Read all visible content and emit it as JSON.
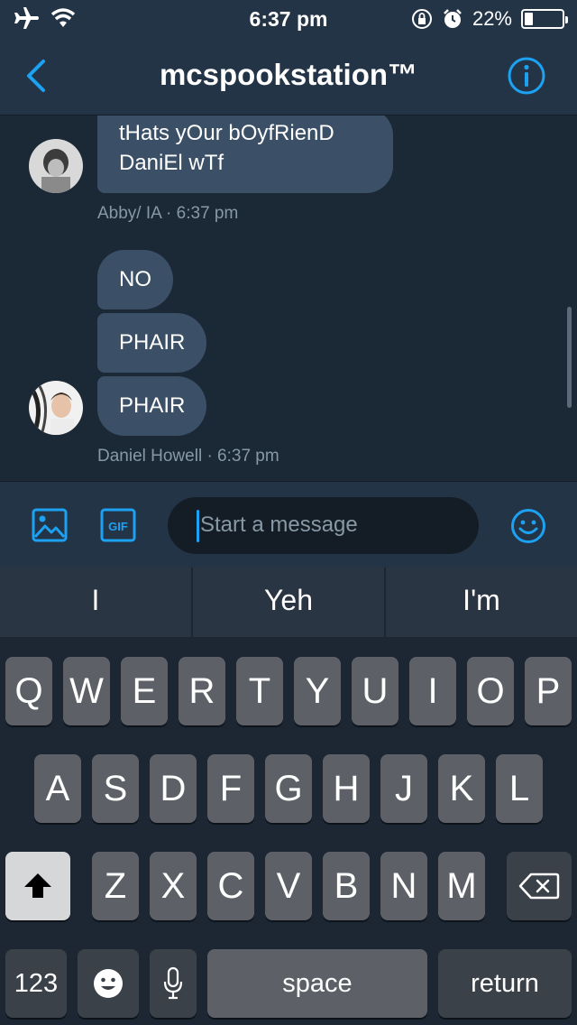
{
  "status_bar": {
    "time": "6:37 pm",
    "battery_text": "22%",
    "battery_level": 0.22
  },
  "header": {
    "title": "mcspookstation™"
  },
  "messages": [
    {
      "text_line1": "tHats yOur bOyfRienD",
      "text_line2": "DaniEl wTf",
      "meta": "Abby/ IA · 6:37 pm"
    },
    {
      "texts": [
        "NO",
        "PHAIR",
        "PHAIR"
      ],
      "meta": "Daniel Howell · 6:37 pm"
    }
  ],
  "composer": {
    "placeholder": "Start a message",
    "gif_label": "GIF"
  },
  "keyboard": {
    "suggestions": [
      "I",
      "Yeh",
      "I'm"
    ],
    "row1": [
      "Q",
      "W",
      "E",
      "R",
      "T",
      "Y",
      "U",
      "I",
      "O",
      "P"
    ],
    "row2": [
      "A",
      "S",
      "D",
      "F",
      "G",
      "H",
      "J",
      "K",
      "L"
    ],
    "row3": [
      "Z",
      "X",
      "C",
      "V",
      "B",
      "N",
      "M"
    ],
    "numbers_label": "123",
    "space_label": "space",
    "return_label": "return"
  },
  "colors": {
    "accent": "#1da1f2",
    "bubble": "#3b5066",
    "background": "#1b2836",
    "header": "#243447"
  }
}
